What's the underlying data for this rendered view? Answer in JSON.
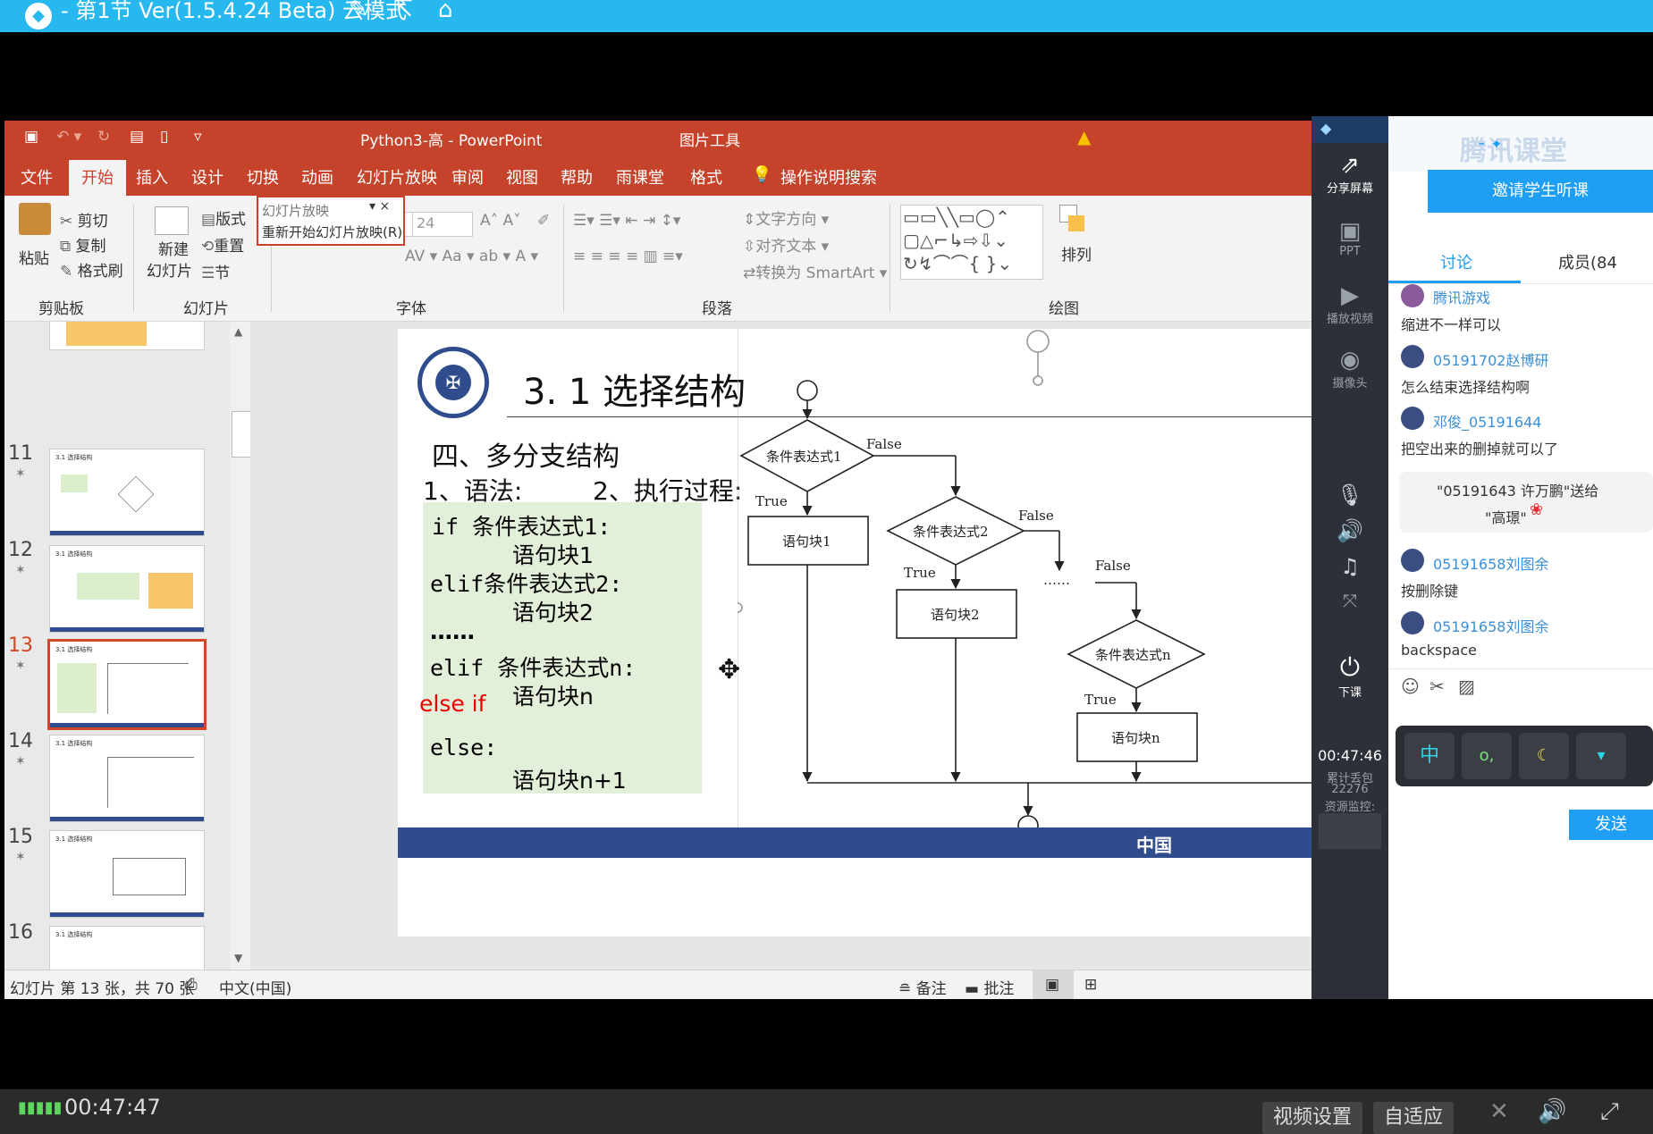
{
  "player": {
    "title": "- 第1节 Ver(1.5.4.24 Beta) 云模式",
    "time": "00:47:47",
    "video_settings": "视频设置",
    "adaptive": "自适应"
  },
  "ppt": {
    "title": "Python3-高  -  PowerPoint",
    "picture_tools": "图片工具",
    "tabs": [
      "文件",
      "开始",
      "插入",
      "设计",
      "切换",
      "动画",
      "幻灯片放映",
      "审阅",
      "视图",
      "帮助",
      "雨课堂",
      "格式"
    ],
    "search": "操作说明搜索",
    "ribbon": {
      "paste": "粘贴",
      "cut": "剪切",
      "copy": "复制",
      "format_painter": "格式刷",
      "clipboard": "剪贴板",
      "new_slide_1": "新建",
      "new_slide_2": "幻灯片",
      "layout": "版式",
      "reset": "重置",
      "section": "节",
      "slides_group": "幻灯片",
      "slideshow_field": "幻灯片放映",
      "restart_slideshow": "重新开始幻灯片放映(R)",
      "font_size": "24",
      "font_group": "字体",
      "text_direction": "文字方向",
      "align_text": "对齐文本",
      "convert_smartart": "转换为 SmartArt",
      "paragraph_group": "段落",
      "arrange": "排列",
      "drawing_group": "绘图"
    },
    "thumbnails": [
      {
        "num": "11",
        "title": "3.1 选择结构"
      },
      {
        "num": "12",
        "title": "3.1 选择结构"
      },
      {
        "num": "13",
        "title": "3.1 选择结构"
      },
      {
        "num": "14",
        "title": "3.1 选择结构"
      },
      {
        "num": "15",
        "title": "3.1 选择结构"
      },
      {
        "num": "16",
        "title": "3.1 选择结构"
      }
    ],
    "slide": {
      "heading": "3. 1  选择结构",
      "subheading": "四、多分支结构",
      "syntax_label": "1、语法:",
      "exec_label": "2、执行过程:",
      "code": [
        "if  条件表达式1:",
        "语句块1",
        "elif条件表达式2:",
        "语句块2",
        "……",
        "elif 条件表达式n:",
        "语句块n",
        "else:",
        "语句块n+1"
      ],
      "annotation": "else if",
      "flow": {
        "cond1": "条件表达式1",
        "cond2": "条件表达式2",
        "condn": "条件表达式n",
        "block1": "语句块1",
        "block2": "语句块2",
        "blockn": "语句块n",
        "true": "True",
        "false": "False",
        "dots": "……"
      },
      "footer": "中国"
    },
    "status": {
      "slide_info": "幻灯片 第 13 张，共 70 张",
      "language": "中文(中国)",
      "notes": "备注",
      "comments": "批注"
    }
  },
  "panel": {
    "brand": "腾讯课堂",
    "invite": "邀请学生听课",
    "tab_discuss": "讨论",
    "tab_members": "成员(84",
    "tools": [
      "分享屏幕",
      "PPT",
      "播放视频",
      "摄像头",
      "下课"
    ],
    "timer": "00:47:46",
    "loss_label": "累计丢包",
    "loss_value": "22276",
    "monitor": "资源监控:",
    "messages": [
      {
        "name": "腾讯游戏",
        "text": "缩进不一样可以"
      },
      {
        "name": "05191702赵博研",
        "text": "怎么结束选择结构啊"
      },
      {
        "name": "邓俊_05191644",
        "text": "把空出来的删掉就可以了"
      },
      {
        "name": "05191658刘图余",
        "text": "按删除键"
      },
      {
        "name": "05191658刘图余",
        "text": "backspace"
      }
    ],
    "gift_line1": "\"05191643 许万鹏\"送给",
    "gift_line2": "\"高璟\"",
    "send": "发送",
    "ime": "中"
  },
  "colors": {
    "player_blue": "#28b8f0",
    "ppt_red": "#c5432a",
    "slide_navy": "#2f4c8c",
    "code_green": "#e2efd9",
    "panel_dark": "#2d3038",
    "invite_blue": "#1f9ef5"
  }
}
